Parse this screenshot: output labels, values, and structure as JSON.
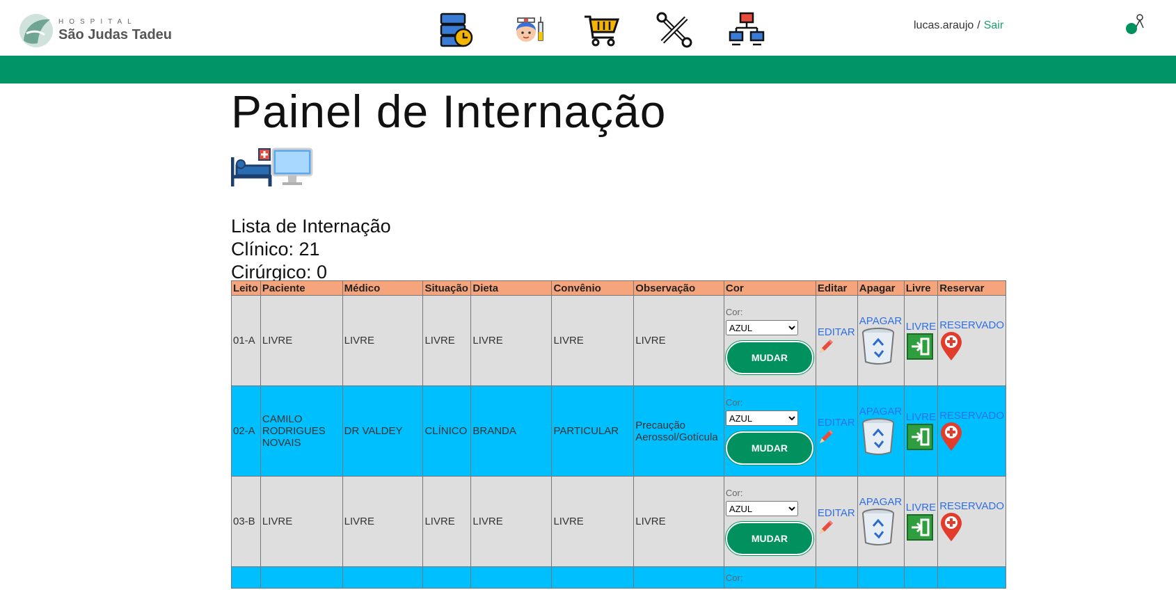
{
  "header": {
    "logo_small": "HOSPITAL",
    "logo_big": "São Judas Tadeu",
    "nav_icons": [
      "server-clock-icon",
      "nurse-icon",
      "shopping-cart-icon",
      "tools-icon",
      "network-icon"
    ],
    "username": "lucas.araujo",
    "separator": "/",
    "logout": "Sair"
  },
  "page": {
    "title": "Painel de Internação",
    "list_title": "Lista de Internação",
    "clinico": "Clínico: 21",
    "cirurgico": "Cirúrgico: 0"
  },
  "table": {
    "headers": [
      "Leito",
      "Paciente",
      "Médico",
      "Situação",
      "Dieta",
      "Convênio",
      "Observação",
      "Cor",
      "Editar",
      "Apagar",
      "Livre",
      "Reservar"
    ],
    "cor_label": "Cor:",
    "select_value": "AZUL",
    "button_label": "MUDAR",
    "edit_label": "EDITAR",
    "delete_label": "APAGAR",
    "free_label": "LIVRE",
    "reserve_label": "RESERVADO",
    "rows": [
      {
        "leito": "01-A",
        "paciente": "LIVRE",
        "medico": "LIVRE",
        "situacao": "LIVRE",
        "dieta": "LIVRE",
        "convenio": "LIVRE",
        "observacao": "LIVRE"
      },
      {
        "leito": "02-A",
        "paciente": "CAMILO RODRIGUES NOVAIS",
        "medico": "DR VALDEY",
        "situacao": "CLÍNICO",
        "dieta": "BRANDA",
        "convenio": "PARTICULAR",
        "observacao": "Precaução Aerossol/Gotícula"
      },
      {
        "leito": "03-B",
        "paciente": "LIVRE",
        "medico": "LIVRE",
        "situacao": "LIVRE",
        "dieta": "LIVRE",
        "convenio": "LIVRE",
        "observacao": "LIVRE"
      }
    ]
  },
  "colors": {
    "green": "#009467",
    "header_orange": "#f6a47c",
    "row_gray": "#dedede",
    "row_blue": "#00bfff"
  }
}
